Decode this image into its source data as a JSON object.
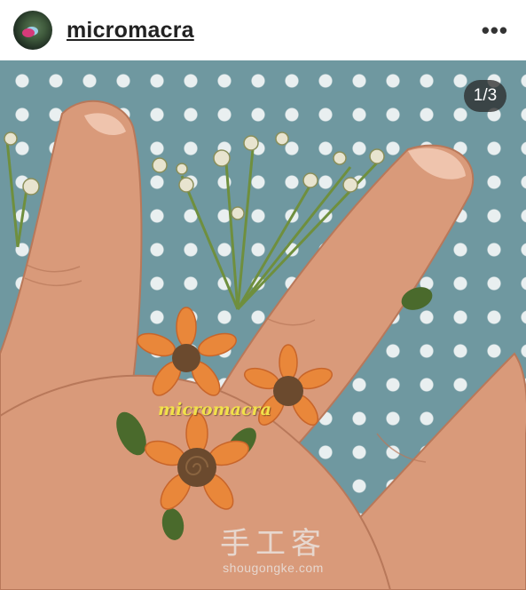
{
  "post": {
    "username": "micromacra",
    "more_icon": "more-horizontal-icon",
    "counter": "1/3",
    "watermark": "micromacra",
    "site_logo": "手工客",
    "site_url": "shougongke.com"
  },
  "colors": {
    "background": "#6f98a0",
    "dots": "#e9eff0",
    "flower_orange": "#e9873a",
    "flower_center": "#6b4a2e",
    "leaf_green": "#4a6a2c"
  }
}
